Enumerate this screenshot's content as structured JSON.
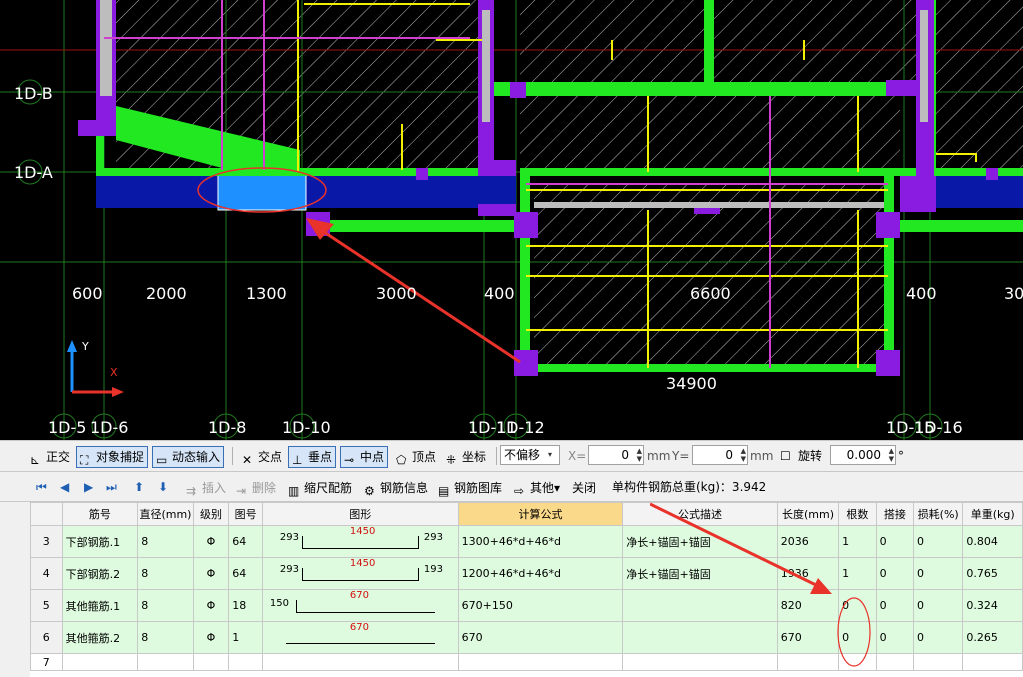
{
  "canvas": {
    "row_axes": [
      "1D-B",
      "1D-A"
    ],
    "col_axes": [
      "1D-5",
      "1D-6",
      "1D-8",
      "1D-10",
      "1D-11",
      "1D-12",
      "1D-15",
      "1D-16"
    ],
    "dimensions": [
      "600",
      "2000",
      "1300",
      "3000",
      "400",
      "6600",
      "400",
      "30"
    ],
    "total_dimension": "34900",
    "ucs_y": "Y",
    "ucs_x": "X"
  },
  "toolbar1": {
    "ortho": "正交",
    "object_snap": "对象捕捉",
    "dynamic_input": "动态输入",
    "intersection": "交点",
    "perpendicular": "垂点",
    "midpoint": "中点",
    "vertex": "顶点",
    "coordinate": "坐标",
    "offset_mode": "不偏移",
    "x_label": "X=",
    "x_value": "0",
    "unit_mm": "mm",
    "y_label": "Y=",
    "y_value": "0",
    "rotate_label": "旋转",
    "rotate_value": "0.000",
    "degree": "°"
  },
  "toolbar2": {
    "insert": "插入",
    "delete": "删除",
    "scale_rebar": "缩尺配筋",
    "rebar_info": "钢筋信息",
    "rebar_library": "钢筋图库",
    "other": "其他",
    "close": "关闭",
    "total_weight": "单构件钢筋总重(kg)：3.942"
  },
  "table": {
    "headers": [
      "筋号",
      "直径(mm)",
      "级别",
      "图号",
      "图形",
      "计算公式",
      "公式描述",
      "长度(mm)",
      "根数",
      "搭接",
      "损耗(%)",
      "单重(kg)"
    ],
    "rows": [
      {
        "no": "3",
        "name": "下部钢筋.1",
        "dia": "8",
        "grade": "Φ",
        "fig": "64",
        "shape_left": "293",
        "shape_mid": "1450",
        "shape_right": "293",
        "formula": "1300+46*d+46*d",
        "desc": "净长+锚固+锚固",
        "length": "2036",
        "count": "1",
        "lap": "0",
        "loss": "0",
        "weight": "0.804"
      },
      {
        "no": "4",
        "name": "下部钢筋.2",
        "dia": "8",
        "grade": "Φ",
        "fig": "64",
        "shape_left": "293",
        "shape_mid": "1450",
        "shape_right": "193",
        "formula": "1200+46*d+46*d",
        "desc": "净长+锚固+锚固",
        "length": "1936",
        "count": "1",
        "lap": "0",
        "loss": "0",
        "weight": "0.765"
      },
      {
        "no": "5",
        "name": "其他箍筋.1",
        "dia": "8",
        "grade": "Φ",
        "fig": "18",
        "shape_left": "150",
        "shape_mid": "670",
        "shape_right": "",
        "formula": "670+150",
        "desc": "",
        "length": "820",
        "count": "0",
        "lap": "0",
        "loss": "0",
        "weight": "0.324"
      },
      {
        "no": "6",
        "name": "其他箍筋.2",
        "dia": "8",
        "grade": "Φ",
        "fig": "1",
        "shape_left": "",
        "shape_mid": "670",
        "shape_right": "",
        "formula": "670",
        "desc": "",
        "length": "670",
        "count": "0",
        "lap": "0",
        "loss": "0",
        "weight": "0.265"
      },
      {
        "no": "7",
        "name": "",
        "dia": "",
        "grade": "",
        "fig": "",
        "shape_left": "",
        "shape_mid": "",
        "shape_right": "",
        "formula": "",
        "desc": "",
        "length": "",
        "count": "",
        "lap": "",
        "loss": "",
        "weight": ""
      }
    ]
  },
  "colors": {
    "wall_green": "#22e822",
    "column_purple": "#8a1be0",
    "beam_blue": "#0a18a8",
    "selected_blue": "#1e90ff",
    "annotation_red": "#e8322a",
    "grid_green": "#1f7a1f",
    "rebar_yellow": "#f0f000",
    "rebar_magenta": "#d040d0",
    "row_green": "#dffbdf",
    "header_highlight": "#fbd98a"
  }
}
